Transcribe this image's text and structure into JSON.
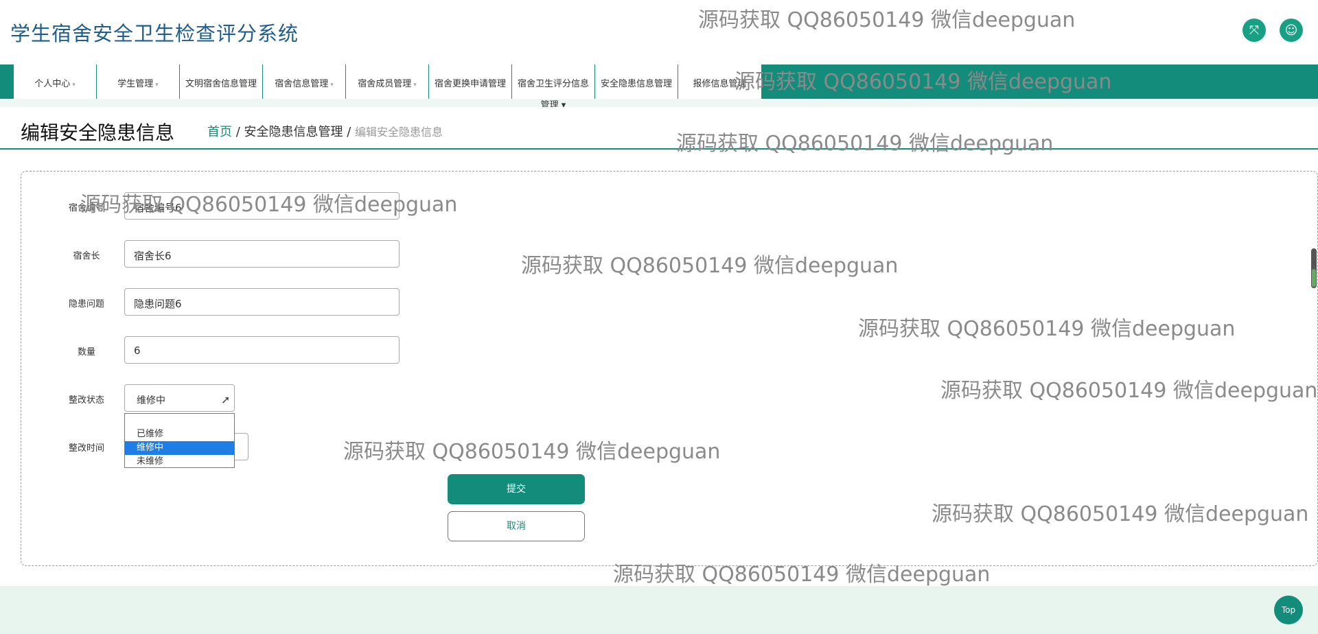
{
  "app": {
    "title": "学生宿舍安全卫生检查评分系统"
  },
  "header": {
    "expand_icon": "fullscreen-icon",
    "user_icon": "user-icon"
  },
  "nav": {
    "items": [
      {
        "label": "个人中心",
        "caret": "▾"
      },
      {
        "label": "学生管理",
        "caret": "▾"
      },
      {
        "label": "文明宿舍信息管理",
        "below": "▾"
      },
      {
        "label": "宿舍信息管理",
        "caret": "▾"
      },
      {
        "label": "宿舍成员管理",
        "caret": "▾"
      },
      {
        "label": "宿舍更换申请管理",
        "below": "▾"
      },
      {
        "label": "宿舍卫生评分信息",
        "below": "管理 ▾"
      },
      {
        "label": "安全隐患信息管理",
        "below": "▾"
      },
      {
        "label": "报修信息管理",
        "caret": ""
      }
    ]
  },
  "page": {
    "title": "编辑安全隐患信息",
    "breadcrumb": {
      "home": "首页",
      "sep1": " / ",
      "parent": "安全隐患信息管理",
      "sep2": " / ",
      "current": "编辑安全隐患信息"
    }
  },
  "form": {
    "dorm_no": {
      "label": "宿舍编号",
      "value": "宿舍编号6"
    },
    "leader": {
      "label": "宿舍长",
      "value": "宿舍长6"
    },
    "issue": {
      "label": "隐患问题",
      "value": "隐患问题6"
    },
    "quantity": {
      "label": "数量",
      "value": "6"
    },
    "status": {
      "label": "整改状态",
      "value": "维修中",
      "options": [
        "",
        "已维修",
        "维修中",
        "未维修"
      ],
      "selected": "维修中"
    },
    "fix_time": {
      "label": "整改时间",
      "value": ""
    },
    "submit": "提交",
    "cancel": "取消"
  },
  "footer": {
    "top_label": "Top"
  },
  "watermark": "源码获取 QQ86050149 微信deepguan"
}
